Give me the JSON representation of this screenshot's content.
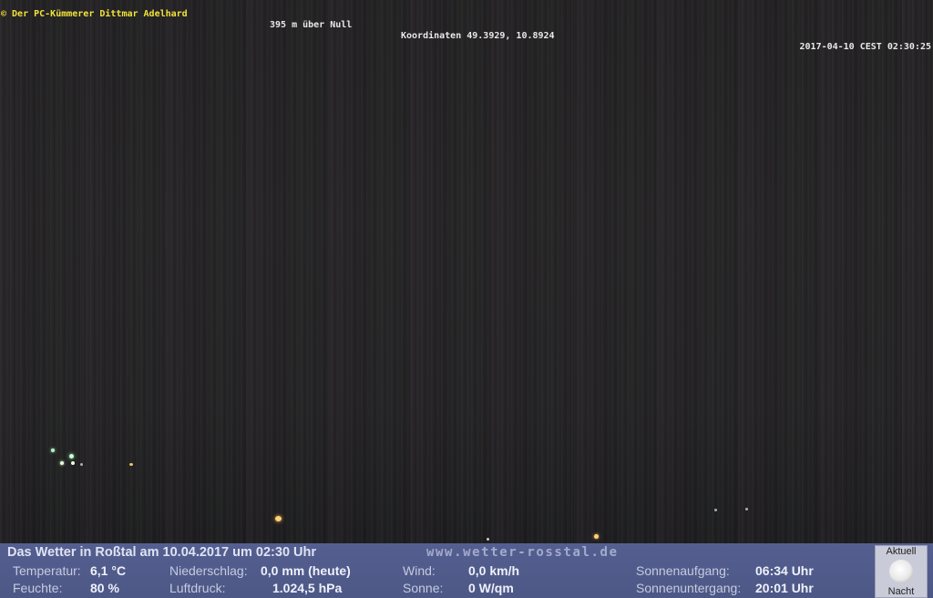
{
  "overlay": {
    "copyright": "© Der PC-Kümmerer Dittmar Adelhard",
    "altitude": "395 m über Null",
    "coordinates": "Koordinaten 49.3929, 10.8924",
    "timestamp": "2017-04-10 CEST 02:30:25"
  },
  "weather": {
    "title": "Das Wetter in Roßtal am 10.04.2017 um 02:30 Uhr",
    "website": "www.wetter-rosstal.de",
    "temperature_label": "Temperatur:",
    "temperature_value": "6,1 °C",
    "humidity_label": "Feuchte:",
    "humidity_value": "80 %",
    "precipitation_label": "Niederschlag:",
    "precipitation_value": "0,0 mm (heute)",
    "pressure_label": "Luftdruck:",
    "pressure_value": "1.024,5 hPa",
    "wind_label": "Wind:",
    "wind_value": "0,0 km/h",
    "sun_label": "Sonne:",
    "sun_value": "0 W/qm",
    "sunrise_label": "Sonnenaufgang:",
    "sunrise_value": "06:34 Uhr",
    "sunset_label": "Sonnenuntergang:",
    "sunset_value": "20:01 Uhr",
    "moon_top_label": "Aktuell",
    "moon_bottom_label": "Nacht"
  },
  "colors": {
    "panel_bg": "#545f90",
    "copyright_text": "#f2e23a"
  }
}
